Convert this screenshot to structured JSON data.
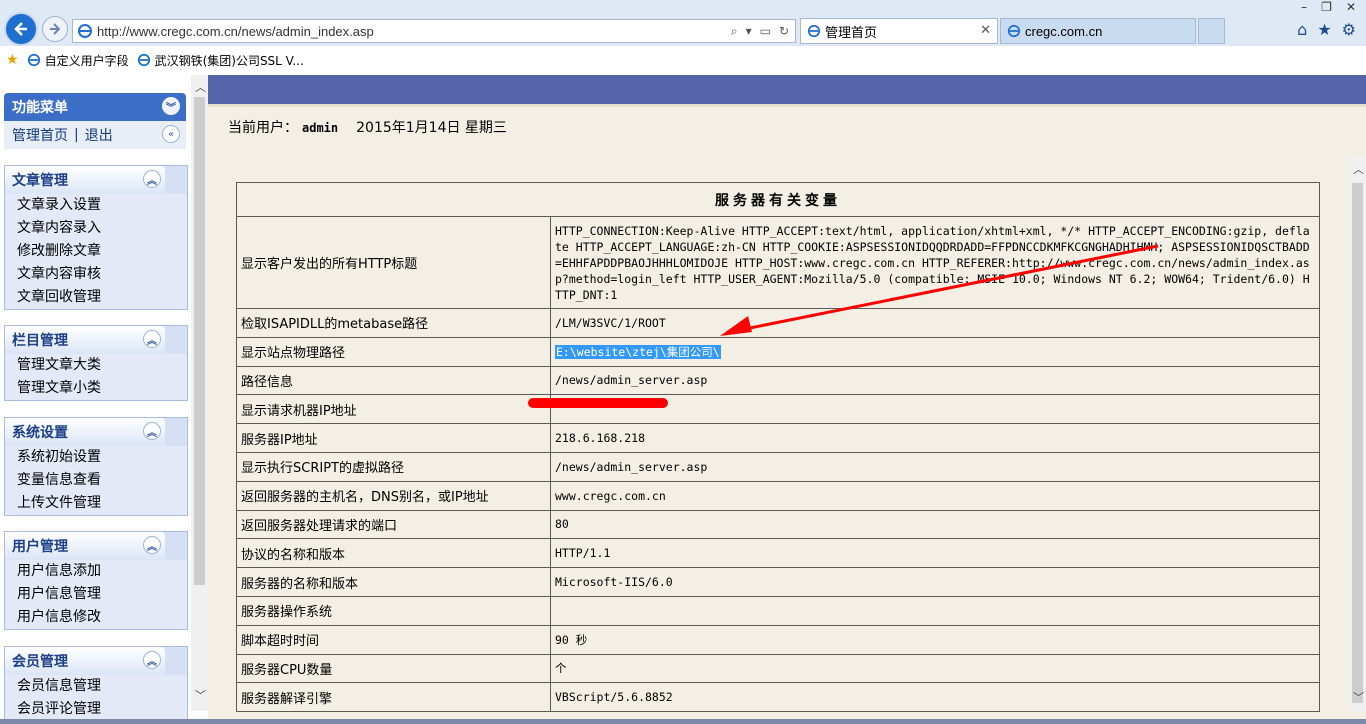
{
  "browser": {
    "url": "http://www.cregc.com.cn/news/admin_index.asp",
    "tabs": [
      {
        "label": "管理首页"
      },
      {
        "label": "cregc.com.cn"
      }
    ],
    "favorites": [
      {
        "label": "自定义用户字段"
      },
      {
        "label": "武汉钢铁(集团)公司SSL V..."
      }
    ]
  },
  "sidebar": {
    "title": "功能菜单",
    "home_label": "管理首页",
    "logout_label": "退出",
    "separator": "|",
    "groups": [
      {
        "title": "文章管理",
        "items": [
          "文章录入设置",
          "文章内容录入",
          "修改删除文章",
          "文章内容审核",
          "文章回收管理"
        ]
      },
      {
        "title": "栏目管理",
        "items": [
          "管理文章大类",
          "管理文章小类"
        ]
      },
      {
        "title": "系统设置",
        "items": [
          "系统初始设置",
          "变量信息查看",
          "上传文件管理"
        ]
      },
      {
        "title": "用户管理",
        "items": [
          "用户信息添加",
          "用户信息管理",
          "用户信息修改"
        ]
      },
      {
        "title": "会员管理",
        "items": [
          "会员信息管理",
          "会员评论管理"
        ]
      }
    ]
  },
  "main": {
    "current_user_label": "当前用户：",
    "current_user": "admin",
    "date": "2015年1月14日 星期三",
    "table_title": "服务器有关变量",
    "rows": [
      {
        "key": "显示客户发出的所有HTTP标题",
        "value": "HTTP_CONNECTION:Keep-Alive HTTP_ACCEPT:text/html, application/xhtml+xml, */* HTTP_ACCEPT_ENCODING:gzip, deflate HTTP_ACCEPT_LANGUAGE:zh-CN HTTP_COOKIE:ASPSESSIONIDQQDRDADD=FFPDNCCDKMFKCGNGHADHIHMH; ASPSESSIONIDQSCTBADD=EHHFAPDDPBAOJHHHLOMIDOJE HTTP_HOST:www.cregc.com.cn HTTP_REFERER:http://www.cregc.com.cn/news/admin_index.asp?method=login_left HTTP_USER_AGENT:Mozilla/5.0 (compatible; MSIE 10.0; Windows NT 6.2; WOW64; Trident/6.0) HTTP_DNT:1"
      },
      {
        "key": "检取ISAPIDLL的metabase路径",
        "value": "/LM/W3SVC/1/ROOT"
      },
      {
        "key": "显示站点物理路径",
        "value": "E:\\website\\ztej\\集团公司\\"
      },
      {
        "key": "路径信息",
        "value": "/news/admin_server.asp"
      },
      {
        "key": "显示请求机器IP地址",
        "value": ""
      },
      {
        "key": "服务器IP地址",
        "value": "218.6.168.218"
      },
      {
        "key": "显示执行SCRIPT的虚拟路径",
        "value": "/news/admin_server.asp"
      },
      {
        "key": "返回服务器的主机名，DNS别名，或IP地址",
        "value": "www.cregc.com.cn"
      },
      {
        "key": "返回服务器处理请求的端口",
        "value": "80"
      },
      {
        "key": "协议的名称和版本",
        "value": "HTTP/1.1"
      },
      {
        "key": "服务器的名称和版本",
        "value": "Microsoft-IIS/6.0"
      },
      {
        "key": "服务器操作系统",
        "value": ""
      },
      {
        "key": "脚本超时时间",
        "value": "90 秒"
      },
      {
        "key": "服务器CPU数量",
        "value": "个"
      },
      {
        "key": "服务器解译引擎",
        "value": "VBScript/5.6.8852"
      }
    ]
  },
  "colors": {
    "sidebar_header": "#3d6ec7",
    "main_band": "#5563a8",
    "page_bg": "#f3efe4",
    "selection": "#3399ff",
    "annotation": "#ff0000"
  }
}
